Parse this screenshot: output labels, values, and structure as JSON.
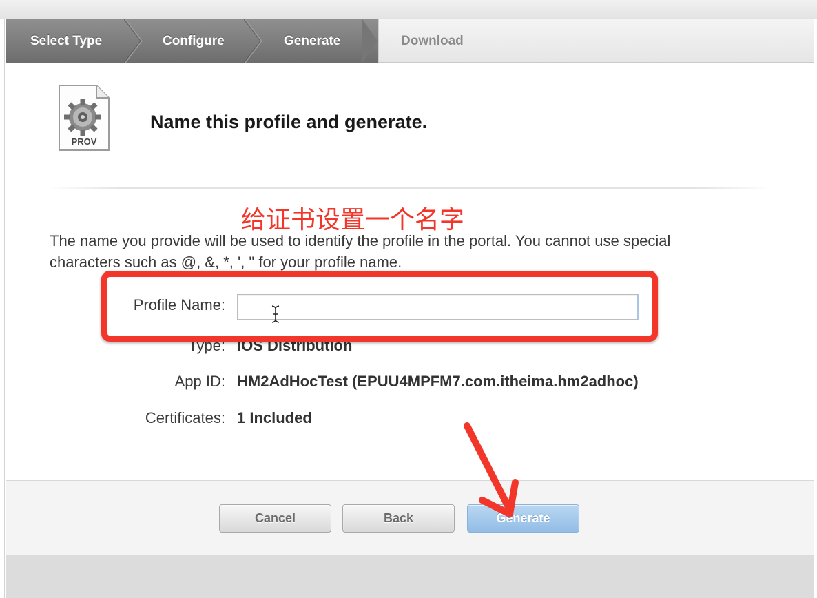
{
  "steps": {
    "items": [
      {
        "label": "Select Type"
      },
      {
        "label": "Configure"
      },
      {
        "label": "Generate"
      },
      {
        "label": "Download"
      }
    ]
  },
  "header": {
    "icon_label": "PROV",
    "title": "Name this profile and generate."
  },
  "annotation": {
    "text": "给证书设置一个名字",
    "color": "#f2362a"
  },
  "description": "The name you provide will be used to identify the profile in the portal. You cannot use special characters such as @, &, *, ', \" for your profile name.",
  "form": {
    "profile_name_label": "Profile Name:",
    "profile_name_value": "",
    "type_label": "Type:",
    "type_value": "iOS Distribution",
    "app_id_label": "App ID:",
    "app_id_value": "HM2AdHocTest (EPUU4MPFM7.com.itheima.hm2adhoc)",
    "certificates_label": "Certificates:",
    "certificates_value": "1 Included"
  },
  "buttons": {
    "cancel": "Cancel",
    "back": "Back",
    "generate": "Generate"
  }
}
